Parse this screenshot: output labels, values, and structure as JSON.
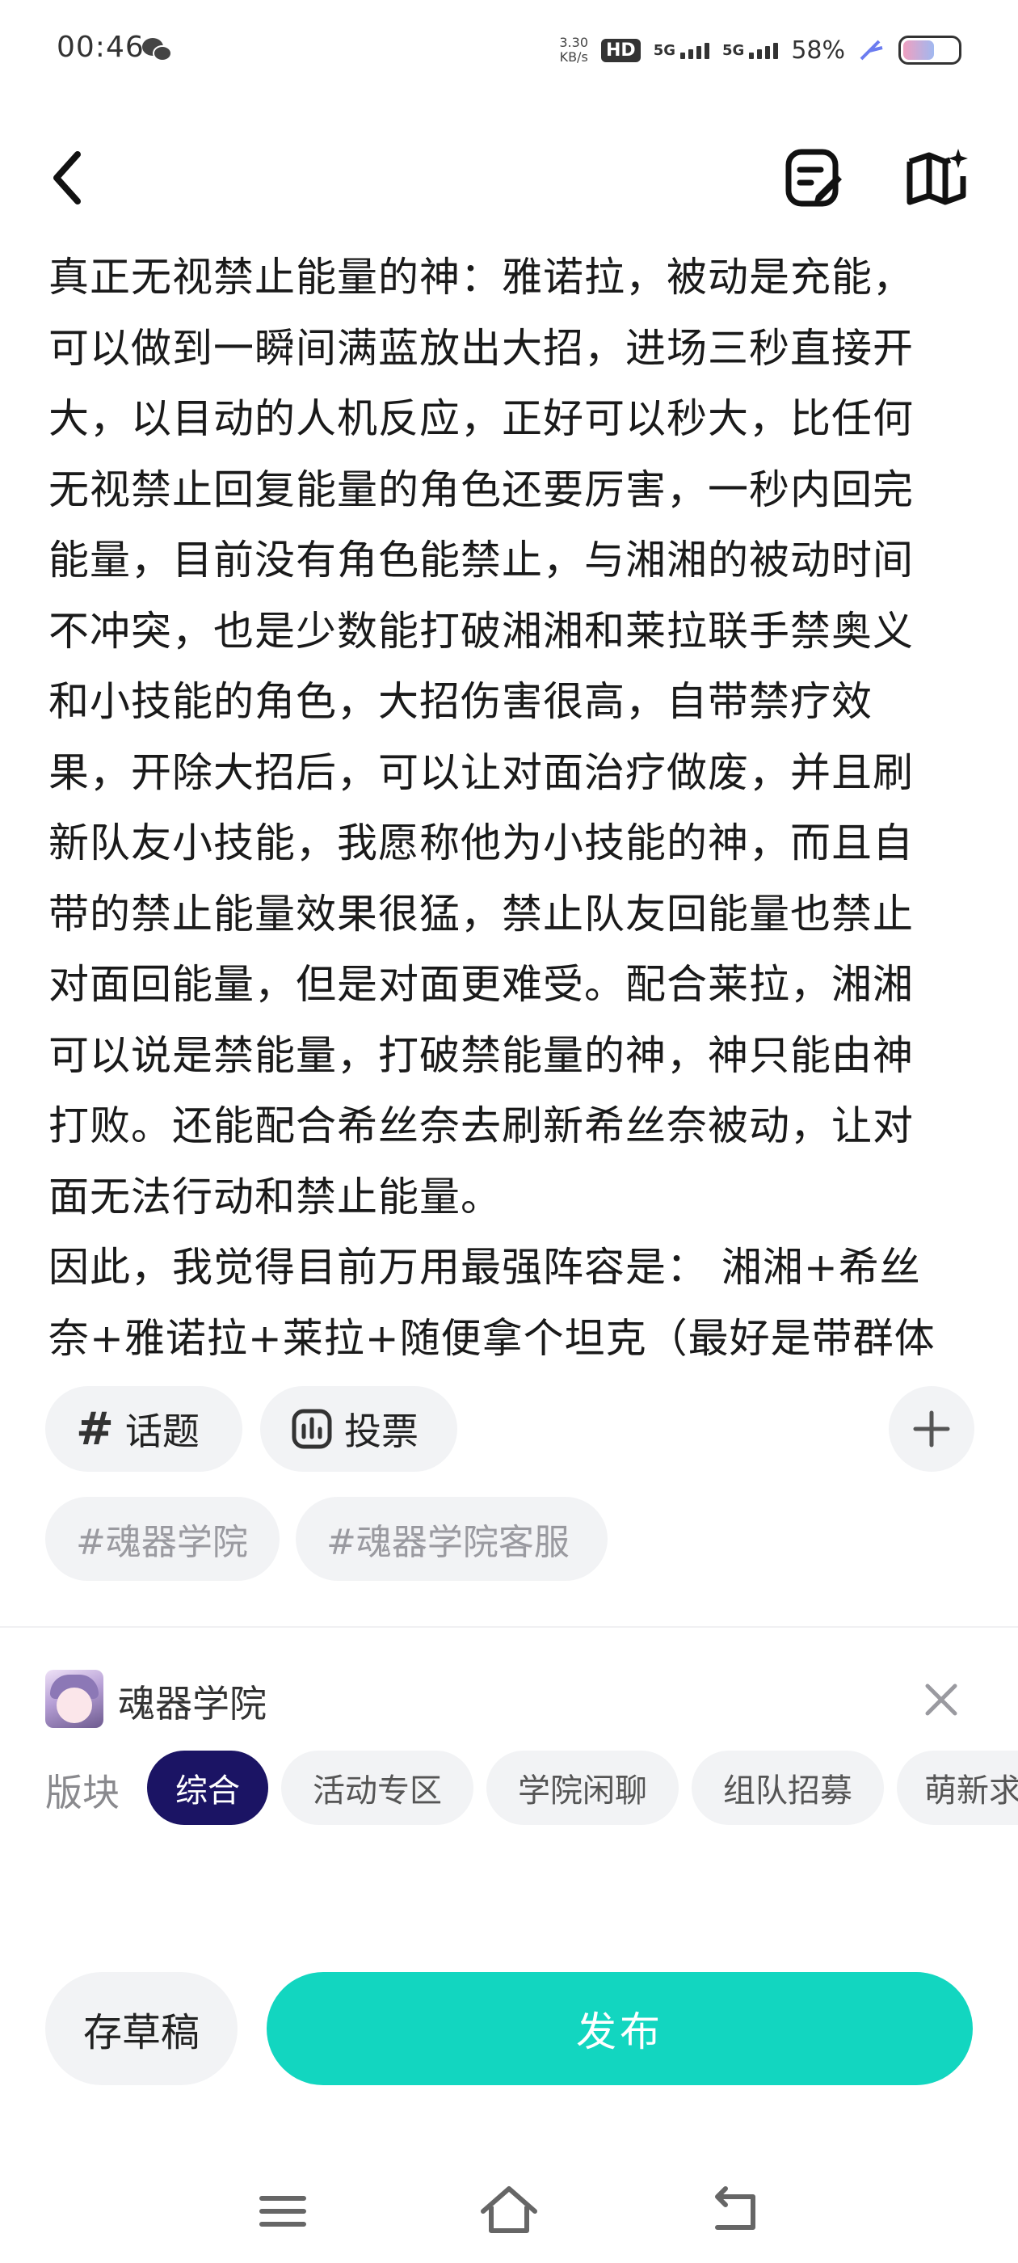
{
  "status_bar": {
    "time": "00:46",
    "net_speed_value": "3.30",
    "net_speed_unit": "KB/s",
    "hd_label": "HD",
    "sim1_label": "5G",
    "sim2_label": "5G",
    "battery_percent": "58%",
    "battery_level": 0.58,
    "icons": [
      "wechat-icon",
      "hd-icon",
      "signal-icon",
      "battery-icon",
      "charging-icon"
    ]
  },
  "nav": {
    "icons": [
      "back-icon",
      "edit-note-icon",
      "book-sparkle-icon"
    ]
  },
  "article": {
    "text": "真正无视禁止能量的神：雅诺拉，被动是充能，可以做到一瞬间满蓝放出大招，进场三秒直接开大，以目动的人机反应，正好可以秒大，比任何无视禁止回复能量的角色还要厉害，一秒内回完能量，目前没有角色能禁止，与湘湘的被动时间不冲突，也是少数能打破湘湘和莱拉联手禁奥义和小技能的角色，大招伤害很高，自带禁疗效果，开除大招后，可以让对面治疗做废，并且刷新队友小技能，我愿称他为小技能的神，而且自带的禁止能量效果很猛，禁止队友回能量也禁止对面回能量，但是对面更难受。配合莱拉，湘湘可以说是禁能量，打破禁能量的神，神只能由神打败。还能配合希丝奈去刷新希丝奈被动，让对面无法行动和禁止能量。\n因此，我觉得目前万用最强阵容是： 湘湘+希丝奈+雅诺拉+莱拉+随便拿个坦克（最好是带群体免"
  },
  "tools": {
    "topic_label": "话题",
    "vote_label": "投票"
  },
  "tags": [
    "#魂器学院",
    "#魂器学院客服"
  ],
  "community": {
    "name": "魂器学院",
    "board_label": "版块",
    "boards": [
      "综合",
      "活动专区",
      "学院闲聊",
      "组队招募",
      "萌新求"
    ],
    "active_board": "综合"
  },
  "actions": {
    "draft_label": "存草稿",
    "publish_label": "发布"
  },
  "colors": {
    "publish": "#12d6c0",
    "active_board": "#1b1464",
    "chip_bg": "#f2f3f5"
  }
}
